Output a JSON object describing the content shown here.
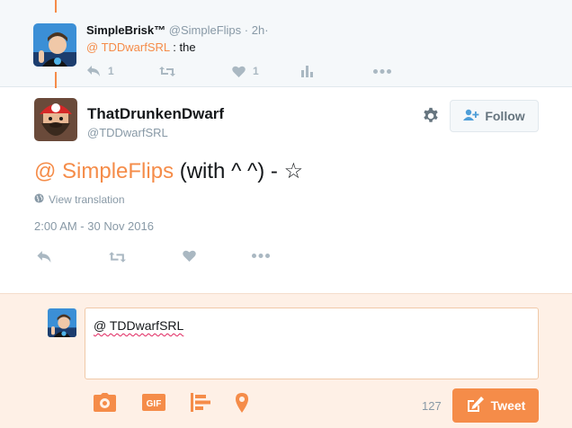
{
  "colors": {
    "accent": "#f58c49",
    "muted": "#8899a6",
    "icon": "#aab8c2",
    "compose_bg": "#fef0e6"
  },
  "reply": {
    "name": "SimpleBrisk™",
    "handle": "@SimpleFlips",
    "time": "· 2h·",
    "mention": "@ TDDwarfSRL",
    "text": " : the",
    "reply_count": "1",
    "like_count": "1"
  },
  "tweet": {
    "name": "ThatDrunkenDwarf",
    "handle": "@TDDwarfSRL",
    "follow_label": "Follow",
    "mention": "@ SimpleFlips",
    "text": " (with ^ ^) - ☆",
    "translation": "View translation",
    "timestamp": "2:00 AM - 30 Nov 2016"
  },
  "compose": {
    "text": "@ TDDwarfSRL",
    "char_count": "127",
    "tweet_label": "Tweet"
  },
  "icons": [
    "reply-icon",
    "retweet-icon",
    "like-icon",
    "analytics-icon",
    "more-icon",
    "gear-icon",
    "follow-person-icon",
    "globe-icon",
    "camera-icon",
    "gif-icon",
    "poll-icon",
    "location-icon",
    "compose-icon"
  ]
}
